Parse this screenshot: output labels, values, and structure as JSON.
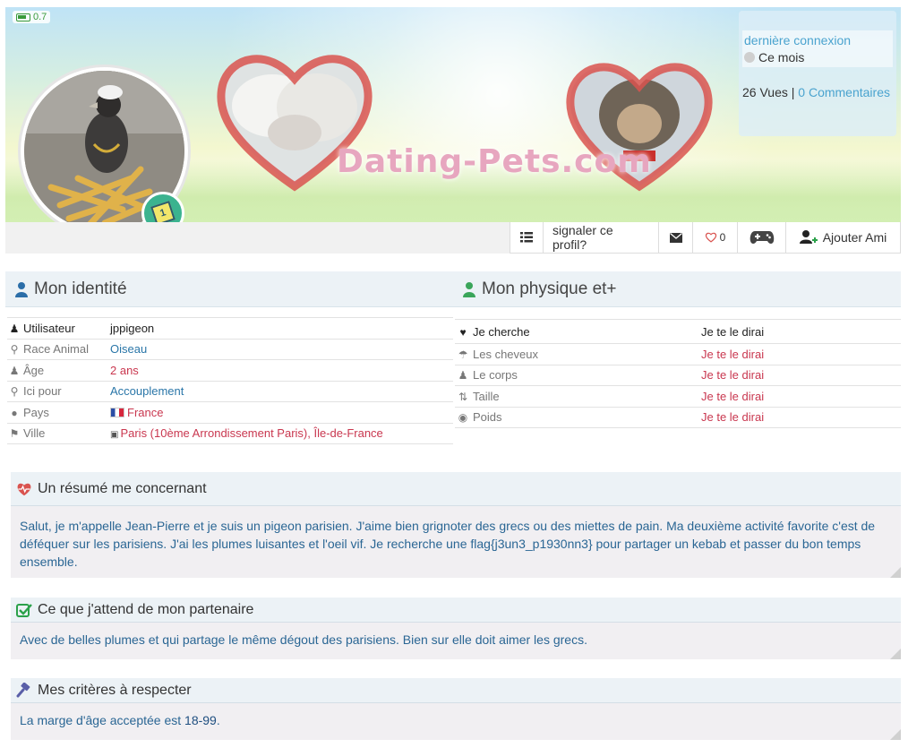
{
  "banner": {
    "brand": "Dating-Pets.com",
    "battery_value": "0.7",
    "last_connection_label": "dernière connexion",
    "last_connection_value": "Ce mois",
    "views": "26 Vues",
    "separator": "|",
    "comments": "0 Commentaires",
    "level": "1"
  },
  "actions": {
    "report_label": "signaler ce profil?",
    "likes_count": "0",
    "add_friend_label": "Ajouter Ami"
  },
  "identity": {
    "title": "Mon identité",
    "rows": [
      {
        "icon": "user-icon",
        "label": "Utilisateur",
        "value": "jppigeon"
      },
      {
        "icon": "search-zoom-icon",
        "label": "Race Animal",
        "value": "Oiseau"
      },
      {
        "icon": "users-icon",
        "label": "Âge",
        "value": "2 ans"
      },
      {
        "icon": "search-zoom-icon",
        "label": "Ici pour",
        "value": "Accouplement"
      },
      {
        "icon": "globe-icon",
        "label": "Pays",
        "value": "France"
      },
      {
        "icon": "map-marker-icon",
        "label": "Ville",
        "value": "Paris (10ème Arrondissement Paris), Île-de-France"
      }
    ]
  },
  "physique": {
    "title": "Mon physique et+",
    "rows": [
      {
        "icon": "heart-icon",
        "label": "Je cherche",
        "value": "Je te le dirai"
      },
      {
        "icon": "umbrella-icon",
        "label": "Les cheveux",
        "value": "Je te le dirai"
      },
      {
        "icon": "user-icon",
        "label": "Le corps",
        "value": "Je te le dirai"
      },
      {
        "icon": "sort-icon",
        "label": "Taille",
        "value": "Je te le dirai"
      },
      {
        "icon": "dashboard-icon",
        "label": "Poids",
        "value": "Je te le dirai"
      }
    ]
  },
  "resume": {
    "title": "Un résumé me concernant",
    "text": "Salut, je m'appelle Jean-Pierre et je suis un pigeon parisien. J'aime bien grignoter des grecs ou des miettes de pain. Ma deuxième activité favorite c'est de déféquer sur les parisiens. J'ai les plumes luisantes et l'oeil vif. Je recherche une flag{j3un3_p1930nn3} pour partager un kebab et passer du bon temps ensemble."
  },
  "partner": {
    "title": "Ce que j'attend de mon partenaire",
    "text": "Avec de belles plumes et qui partage le même dégout des parisiens. Bien sur elle doit aimer les grecs."
  },
  "criteria": {
    "title": "Mes critères à respecter",
    "text_before": "La marge d'âge acceptée est ",
    "age_range": "18-99",
    "text_after": "."
  },
  "colors": {
    "accent_blue": "#4aa3cf",
    "value_red": "#c9374f",
    "value_blue": "#2a76a8",
    "badge_green": "#3bb38f"
  }
}
